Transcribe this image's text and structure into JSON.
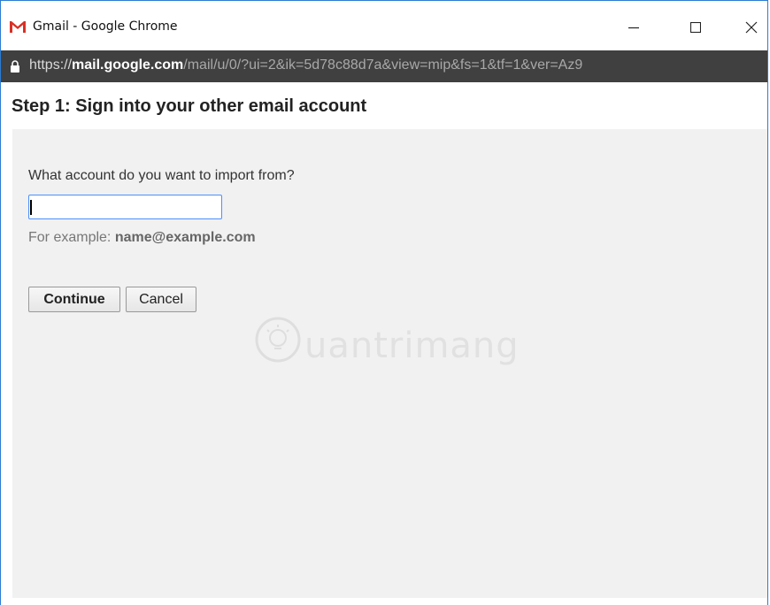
{
  "window": {
    "title": "Gmail - Google Chrome",
    "minimize_icon": "minimize-icon",
    "maximize_icon": "maximize-icon",
    "close_icon": "close-icon"
  },
  "address_bar": {
    "scheme": "https://",
    "host": "mail.google.com",
    "path": "/mail/u/0/?ui=2&ik=5d78c88d7a&view=mip&fs=1&tf=1&ver=Az9"
  },
  "page": {
    "step_title": "Step 1: Sign into your other email account",
    "question": "What account do you want to import from?",
    "email_value": "",
    "example_prefix": "For example: ",
    "example_value": "name@example.com",
    "continue_label": "Continue",
    "cancel_label": "Cancel"
  },
  "watermark": {
    "text": "uantrimang"
  },
  "colors": {
    "gmail_red": "#d93025",
    "address_bar_bg": "#404040",
    "panel_bg": "#f1f1f1",
    "input_focus_border": "#4d90fe"
  }
}
